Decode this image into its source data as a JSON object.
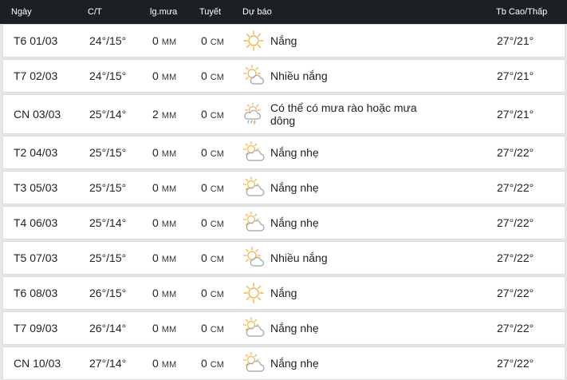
{
  "header": {
    "day": "Ngày",
    "temp": "C/T",
    "rain": "lg.mưa",
    "snow": "Tuyết",
    "forecast": "Dự báo",
    "avg": "Tb Cao/Thấp"
  },
  "rows": [
    {
      "day": "T6 01/03",
      "temp": "24°/15°",
      "rain": "0",
      "rain_unit": "MM",
      "snow": "0",
      "snow_unit": "CM",
      "icon": "sun-icon",
      "desc": "Nắng",
      "avg": "27°/21°"
    },
    {
      "day": "T7 02/03",
      "temp": "24°/15°",
      "rain": "0",
      "rain_unit": "MM",
      "snow": "0",
      "snow_unit": "CM",
      "icon": "partly-sunny-icon",
      "desc": "Nhiều nắng",
      "avg": "27°/21°"
    },
    {
      "day": "CN 03/03",
      "temp": "25°/14°",
      "rain": "2",
      "rain_unit": "MM",
      "snow": "0",
      "snow_unit": "CM",
      "icon": "thunderstorm-icon",
      "desc": "Có thể có mưa rào hoặc mưa dông",
      "avg": "27°/21°"
    },
    {
      "day": "T2 04/03",
      "temp": "25°/15°",
      "rain": "0",
      "rain_unit": "MM",
      "snow": "0",
      "snow_unit": "CM",
      "icon": "partly-cloudy-icon",
      "desc": "Nắng nhẹ",
      "avg": "27°/22°"
    },
    {
      "day": "T3 05/03",
      "temp": "25°/15°",
      "rain": "0",
      "rain_unit": "MM",
      "snow": "0",
      "snow_unit": "CM",
      "icon": "partly-cloudy-icon",
      "desc": "Nắng nhẹ",
      "avg": "27°/22°"
    },
    {
      "day": "T4 06/03",
      "temp": "25°/14°",
      "rain": "0",
      "rain_unit": "MM",
      "snow": "0",
      "snow_unit": "CM",
      "icon": "partly-cloudy-icon",
      "desc": "Nắng nhẹ",
      "avg": "27°/22°"
    },
    {
      "day": "T5 07/03",
      "temp": "25°/15°",
      "rain": "0",
      "rain_unit": "MM",
      "snow": "0",
      "snow_unit": "CM",
      "icon": "partly-sunny-icon",
      "desc": "Nhiều nắng",
      "avg": "27°/22°"
    },
    {
      "day": "T6 08/03",
      "temp": "26°/15°",
      "rain": "0",
      "rain_unit": "MM",
      "snow": "0",
      "snow_unit": "CM",
      "icon": "sun-icon",
      "desc": "Nắng",
      "avg": "27°/22°"
    },
    {
      "day": "T7 09/03",
      "temp": "26°/14°",
      "rain": "0",
      "rain_unit": "MM",
      "snow": "0",
      "snow_unit": "CM",
      "icon": "partly-cloudy-icon",
      "desc": "Nắng nhẹ",
      "avg": "27°/22°"
    },
    {
      "day": "CN 10/03",
      "temp": "27°/14°",
      "rain": "0",
      "rain_unit": "MM",
      "snow": "0",
      "snow_unit": "CM",
      "icon": "partly-cloudy-icon",
      "desc": "Nắng nhẹ",
      "avg": "27°/22°"
    }
  ],
  "colors": {
    "header_bg": "#1c1f24",
    "sun": "#f4b24a",
    "cloud": "#9aa3ad"
  }
}
